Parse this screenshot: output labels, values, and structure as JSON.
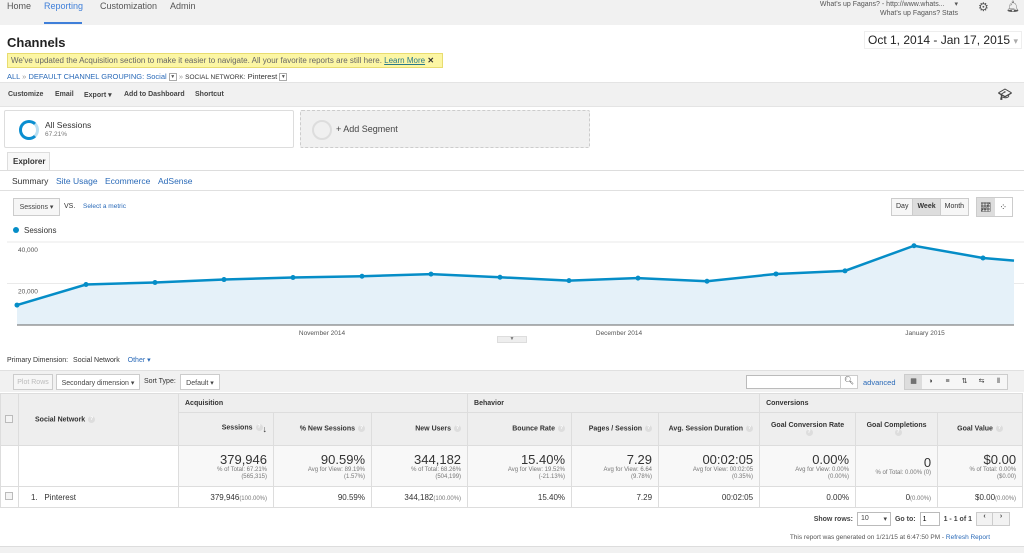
{
  "nav": {
    "items": [
      "Home",
      "Reporting",
      "Customization",
      "Admin"
    ],
    "active": "Reporting",
    "account_view": "What's up Fagans? - http://www.whats...",
    "account_property": "What's up Fagans? Stats"
  },
  "header": {
    "title": "Channels",
    "date_range": "Oct 1, 2014 - Jan 17, 2015"
  },
  "notice": {
    "text": "We've updated the Acquisition section to make it easier to navigate. All your favorite reports are still here.",
    "link": "Learn More",
    "close": "✕"
  },
  "breadcrumb": {
    "all": "ALL",
    "sep": "»",
    "grouping": "DEFAULT CHANNEL GROUPING: Social",
    "network_label": "SOCIAL NETWORK:",
    "network_value": "Pinterest"
  },
  "toolbar": {
    "customize": "Customize",
    "email": "Email",
    "export": "Export ▾",
    "add_dashboard": "Add to Dashboard",
    "shortcut": "Shortcut"
  },
  "segments": {
    "all_sessions": "All Sessions",
    "all_sessions_pct": "67.21%",
    "add": "+ Add Segment"
  },
  "tabs": {
    "explorer": "Explorer",
    "sub": [
      "Summary",
      "Site Usage",
      "Ecommerce",
      "AdSense"
    ]
  },
  "chart_controls": {
    "metric": "Sessions",
    "vs": "VS.",
    "select_metric": "Select a metric",
    "granularity": [
      "Day",
      "Week",
      "Month"
    ],
    "selected_granularity": "Week"
  },
  "chart_data": {
    "type": "area",
    "series": [
      {
        "name": "Sessions",
        "color": "#058dc7",
        "values": [
          9600,
          19500,
          20500,
          21900,
          22900,
          23500,
          24500,
          23000,
          21400,
          22600,
          21100,
          24600,
          26100,
          38200,
          32300,
          31000
        ]
      }
    ],
    "x": [
      "Oct 1, 2014",
      "Oct 5, 2014",
      "Oct 12, 2014",
      "Oct 19, 2014",
      "Oct 26, 2014",
      "Nov 2, 2014",
      "Nov 9, 2014",
      "Nov 16, 2014",
      "Nov 23, 2014",
      "Nov 30, 2014",
      "Dec 7, 2014",
      "Dec 14, 2014",
      "Dec 21, 2014",
      "Dec 28, 2014",
      "Jan 4, 2015",
      "Jan 11, 2015"
    ],
    "yticks": [
      "20,000",
      "40,000"
    ],
    "xticks": [
      "November 2014",
      "December 2014",
      "January 2015"
    ],
    "grid": true,
    "legend": "top-left"
  },
  "dimension": {
    "label": "Primary Dimension:",
    "value": "Social Network",
    "other": "Other ▾"
  },
  "table_toolbar": {
    "plot_rows": "Plot Rows",
    "secondary": "Secondary dimension ▾",
    "sort_label": "Sort Type:",
    "sort_value": "Default ▾",
    "search_placeholder": "",
    "advanced": "advanced"
  },
  "table": {
    "groups": [
      "Acquisition",
      "Behavior",
      "Conversions"
    ],
    "dim_header": "Social Network",
    "columns": [
      "Sessions",
      "% New Sessions",
      "New Users",
      "Bounce Rate",
      "Pages / Session",
      "Avg. Session Duration",
      "Goal Conversion Rate",
      "Goal Completions",
      "Goal Value"
    ],
    "totals": [
      {
        "v": "379,946",
        "s1": "% of Total: 67.21%",
        "s2": "(565,315)"
      },
      {
        "v": "90.59%",
        "s1": "Avg for View: 89.19%",
        "s2": "(1.57%)"
      },
      {
        "v": "344,182",
        "s1": "% of Total: 68.26%",
        "s2": "(504,199)"
      },
      {
        "v": "15.40%",
        "s1": "Avg for View: 19.52%",
        "s2": "(-21.13%)"
      },
      {
        "v": "7.29",
        "s1": "Avg for View: 6.64",
        "s2": "(9.78%)"
      },
      {
        "v": "00:02:05",
        "s1": "Avg for View: 00:02:05",
        "s2": "(0.35%)"
      },
      {
        "v": "0.00%",
        "s1": "Avg for View: 0.00%",
        "s2": "(0.00%)"
      },
      {
        "v": "0",
        "s1": "% of Total: 0.00% (0)",
        "s2": ""
      },
      {
        "v": "$0.00",
        "s1": "% of Total: 0.00%",
        "s2": "($0.00)"
      }
    ],
    "rows": [
      {
        "index": "1.",
        "name": "Pinterest",
        "cells": [
          {
            "v": "379,946",
            "p": "(100.00%)"
          },
          {
            "v": "90.59%",
            "p": ""
          },
          {
            "v": "344,182",
            "p": "(100.00%)"
          },
          {
            "v": "15.40%",
            "p": ""
          },
          {
            "v": "7.29",
            "p": ""
          },
          {
            "v": "00:02:05",
            "p": ""
          },
          {
            "v": "0.00%",
            "p": ""
          },
          {
            "v": "0",
            "p": "(0.00%)"
          },
          {
            "v": "$0.00",
            "p": "(0.00%)"
          }
        ]
      }
    ]
  },
  "pagination": {
    "show_rows": "Show rows:",
    "rows_value": "10",
    "goto": "Go to:",
    "goto_value": "1",
    "range": "1 - 1 of 1"
  },
  "report_footer": {
    "text": "This report was generated on 1/21/15 at 6:47:50 PM -",
    "refresh": "Refresh Report"
  }
}
